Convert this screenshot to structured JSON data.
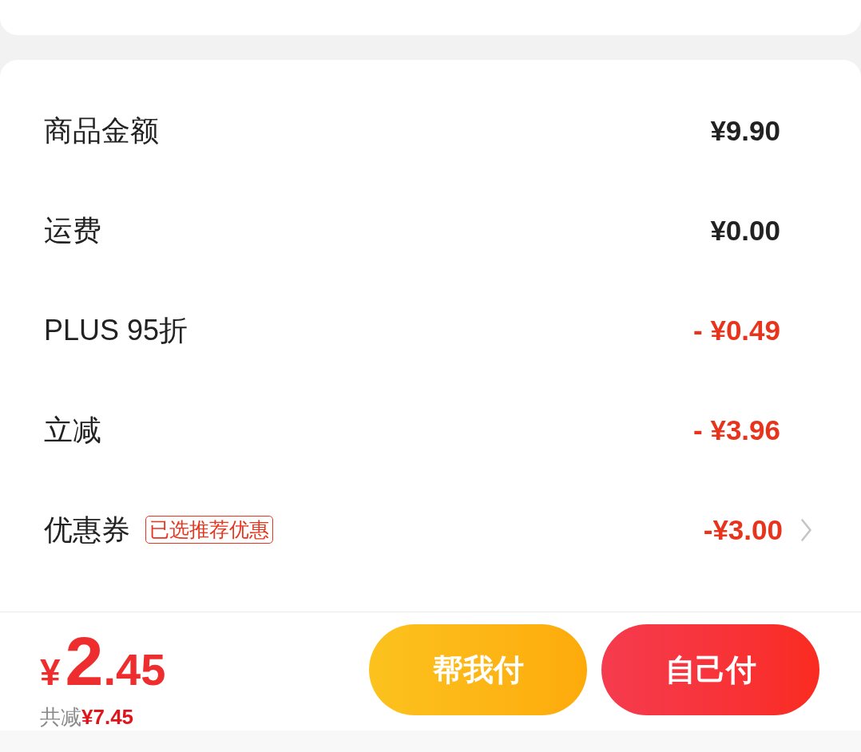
{
  "summary": {
    "rows": [
      {
        "kind": "charge",
        "label": "商品金额",
        "value": "¥9.90"
      },
      {
        "kind": "charge",
        "label": "运费",
        "value": "¥0.00"
      },
      {
        "kind": "discount",
        "label": "PLUS 95折",
        "value": "- ¥0.49"
      },
      {
        "kind": "discount",
        "label": "立减",
        "value": "- ¥3.96"
      },
      {
        "kind": "coupon",
        "label": "优惠券",
        "tag": "已选推荐优惠",
        "value": "-¥3.00"
      }
    ]
  },
  "checkout_bar": {
    "total": {
      "currency": "¥",
      "integer": "2",
      "decimal": ".45"
    },
    "savings": {
      "label": "共减",
      "amount": "¥7.45"
    },
    "buttons": [
      {
        "kind": "secondary",
        "label": "帮我付"
      },
      {
        "kind": "primary",
        "label": "自己付"
      }
    ]
  }
}
